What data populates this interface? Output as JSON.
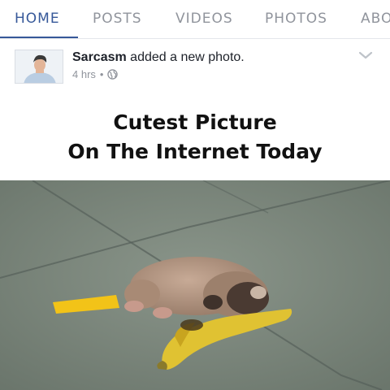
{
  "tabs": [
    {
      "label": "HOME",
      "active": true
    },
    {
      "label": "POSTS",
      "active": false
    },
    {
      "label": "VIDEOS",
      "active": false
    },
    {
      "label": "PHOTOS",
      "active": false
    },
    {
      "label": "ABO",
      "active": false
    }
  ],
  "post": {
    "author": "Sarcasm",
    "action": "added a new photo.",
    "time": "4 hrs",
    "separator": "•",
    "privacy_icon": "globe-icon",
    "menu_icon": "chevron-down-icon"
  },
  "photo": {
    "caption_line1": "Cutest Picture",
    "caption_line2": "On The Internet Today"
  },
  "colors": {
    "accent": "#365899",
    "inactive_tab": "#90949c",
    "floor": "#7f8a80"
  }
}
